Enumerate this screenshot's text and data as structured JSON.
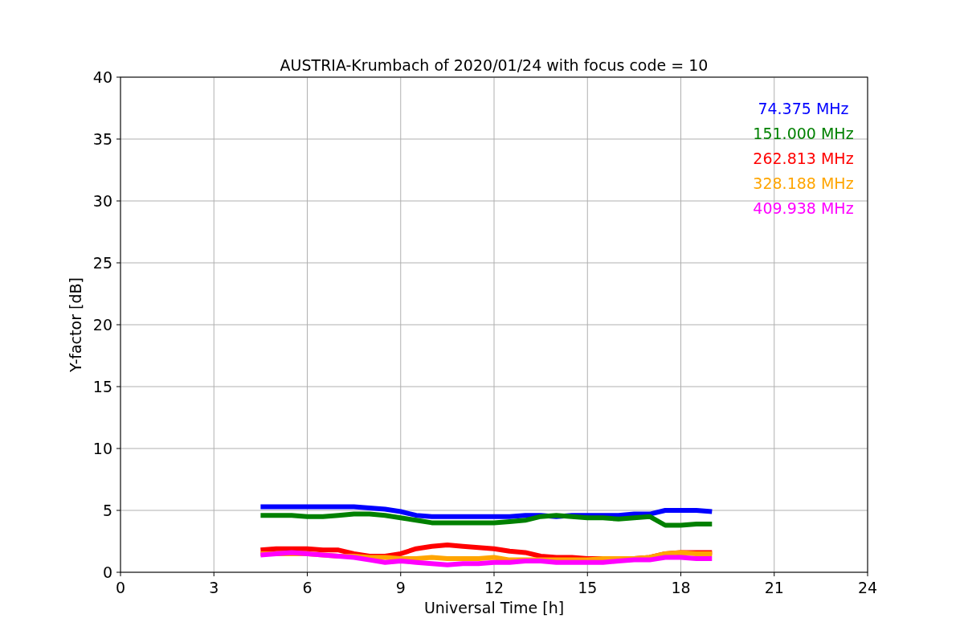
{
  "chart_data": {
    "type": "line",
    "title": "AUSTRIA-Krumbach of 2020/01/24 with focus code = 10",
    "xlabel": "Universal Time [h]",
    "ylabel": "Y-factor [dB]",
    "x": [
      4.5,
      5,
      5.5,
      6,
      6.5,
      7,
      7.5,
      8,
      8.5,
      9,
      9.5,
      10,
      10.5,
      11,
      11.5,
      12,
      12.5,
      13,
      13.5,
      14,
      14.5,
      15,
      15.5,
      16,
      16.5,
      17,
      17.5,
      18,
      18.5,
      19
    ],
    "series": [
      {
        "name": "74.375 MHz",
        "color": "#0000ff",
        "values": [
          5.3,
          5.3,
          5.3,
          5.3,
          5.3,
          5.3,
          5.3,
          5.2,
          5.1,
          4.9,
          4.6,
          4.5,
          4.5,
          4.5,
          4.5,
          4.5,
          4.5,
          4.6,
          4.6,
          4.5,
          4.6,
          4.6,
          4.6,
          4.6,
          4.7,
          4.7,
          5.0,
          5.0,
          5.0,
          4.9
        ]
      },
      {
        "name": "151.000 MHz",
        "color": "#008000",
        "values": [
          4.6,
          4.6,
          4.6,
          4.5,
          4.5,
          4.6,
          4.7,
          4.7,
          4.6,
          4.4,
          4.2,
          4.0,
          4.0,
          4.0,
          4.0,
          4.0,
          4.1,
          4.2,
          4.5,
          4.6,
          4.5,
          4.4,
          4.4,
          4.3,
          4.4,
          4.5,
          3.8,
          3.8,
          3.9,
          3.9
        ]
      },
      {
        "name": "262.813 MHz",
        "color": "#ff0000",
        "values": [
          1.8,
          1.9,
          1.9,
          1.9,
          1.8,
          1.8,
          1.5,
          1.3,
          1.3,
          1.5,
          1.9,
          2.1,
          2.2,
          2.1,
          2.0,
          1.9,
          1.7,
          1.6,
          1.3,
          1.2,
          1.2,
          1.1,
          1.1,
          1.1,
          1.1,
          1.2,
          1.5,
          1.6,
          1.6,
          1.6
        ]
      },
      {
        "name": "328.188 MHz",
        "color": "#ffa500",
        "values": [
          1.5,
          1.5,
          1.5,
          1.5,
          1.4,
          1.3,
          1.3,
          1.2,
          1.2,
          1.1,
          1.1,
          1.2,
          1.1,
          1.1,
          1.1,
          1.2,
          1.0,
          1.0,
          1.0,
          1.0,
          1.0,
          1.0,
          1.1,
          1.1,
          1.1,
          1.2,
          1.5,
          1.6,
          1.5,
          1.5
        ]
      },
      {
        "name": "409.938 MHz",
        "color": "#ff00ff",
        "values": [
          1.4,
          1.5,
          1.6,
          1.5,
          1.4,
          1.3,
          1.2,
          1.0,
          0.8,
          0.9,
          0.8,
          0.7,
          0.6,
          0.7,
          0.7,
          0.8,
          0.8,
          0.9,
          0.9,
          0.8,
          0.8,
          0.8,
          0.8,
          0.9,
          1.0,
          1.0,
          1.2,
          1.2,
          1.1,
          1.1
        ]
      }
    ],
    "grid": true,
    "xlim": [
      0,
      24
    ],
    "ylim": [
      0,
      40
    ],
    "xticks": [
      0,
      3,
      6,
      9,
      12,
      15,
      18,
      21,
      24
    ],
    "yticks": [
      0,
      5,
      10,
      15,
      20,
      25,
      30,
      35,
      40
    ]
  }
}
